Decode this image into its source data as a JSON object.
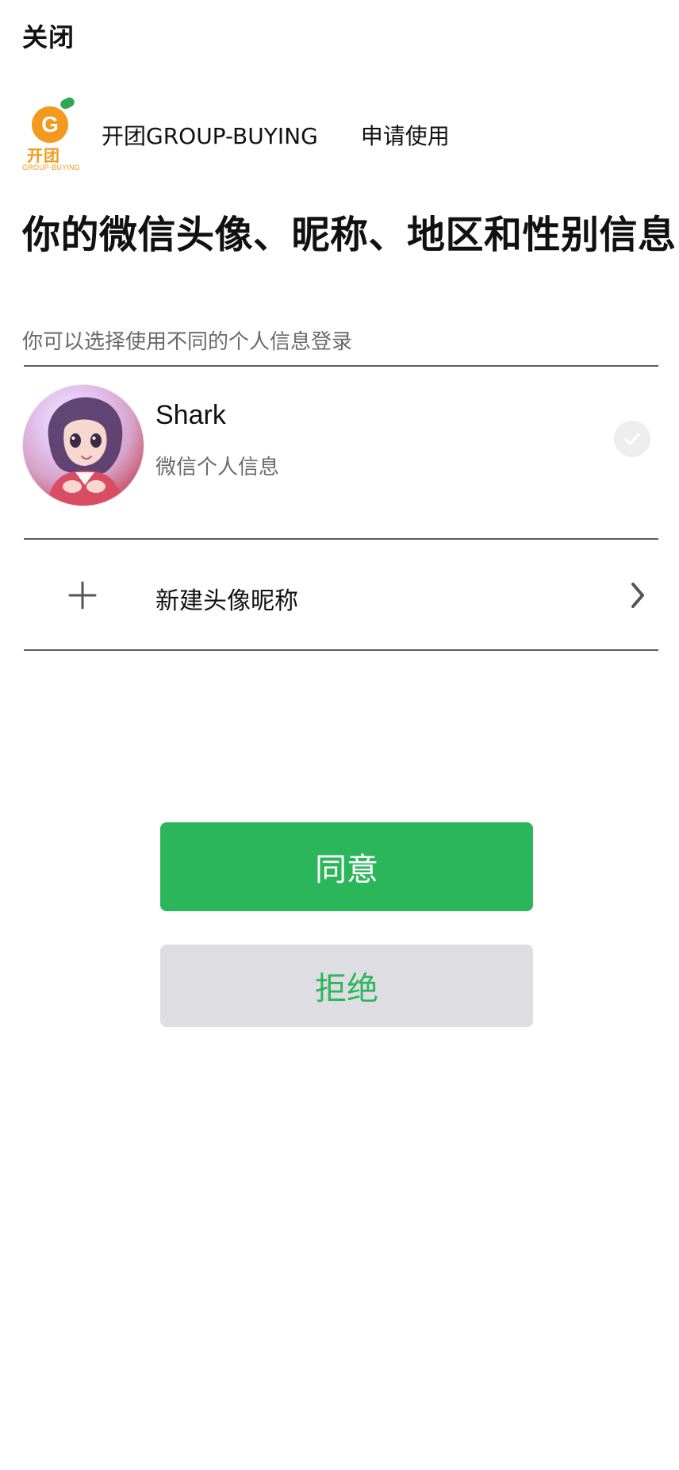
{
  "header": {
    "close_label": "关闭"
  },
  "app": {
    "logo_lettering": {
      "letter": "G",
      "cn": "开团",
      "en": "GROUP-BUYING"
    },
    "name": "开团GROUP-BUYING",
    "request_text": "申请使用"
  },
  "main": {
    "title": "你的微信头像、昵称、地区和性别信息",
    "subtitle": "你可以选择使用不同的个人信息登录"
  },
  "profile": {
    "name": "Shark",
    "subtext": "微信个人信息",
    "selected": true
  },
  "new_profile": {
    "label": "新建头像昵称"
  },
  "actions": {
    "agree_label": "同意",
    "refuse_label": "拒绝"
  },
  "colors": {
    "accent_green": "#2bb65c",
    "refuse_bg": "#dedde2",
    "divider": "#5e5e5e",
    "subtitle_gray": "#6a6a6a"
  },
  "icons": {
    "plus": "plus-icon",
    "chevron": "chevron-right-icon",
    "check": "check-icon"
  }
}
